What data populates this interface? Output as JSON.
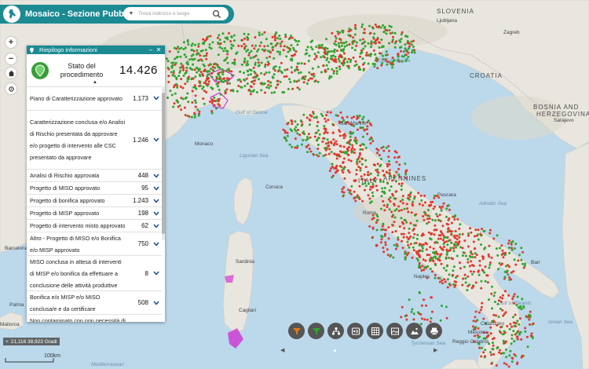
{
  "app": {
    "title": "Mosaico - Sezione Pubblica",
    "search_placeholder": "Trova indirizzo o luogo"
  },
  "nav": {
    "zoom_in": "+",
    "zoom_out": "−"
  },
  "panel": {
    "title": "Riepilogo informazioni",
    "header_label": "Stato del procedimento",
    "total": "14.426",
    "rows": [
      {
        "label": "Piano di Caratterizzazione approvato",
        "value": "1.173"
      },
      {
        "label": "Caratterizzazione conclusa e/o Analisi di Rischio presentata da approvare e/o progetto di intervento alle CSC presentato da approvare",
        "value": "1.246"
      },
      {
        "label": "Analisi di Rischio approvata",
        "value": "448"
      },
      {
        "label": "Progetto di MISO approvato",
        "value": "95"
      },
      {
        "label": "Progetto di bonifica approvato",
        "value": "1.243"
      },
      {
        "label": "Progetto di MISP approvato",
        "value": "198"
      },
      {
        "label": "Progetto di intervento misto approvato",
        "value": "62"
      },
      {
        "label": "Altro - Progetto di MISO e/o Bonifica e/o MISP approvato",
        "value": "750"
      },
      {
        "label": "MISO conclusa in attesa di interventi di MISP e/o bonifica da effettuare a conclusione delle attività produttive",
        "value": "8"
      },
      {
        "label": "Bonifica e/o MISP e/o MISO conclusa/e e da certificare",
        "value": "508"
      },
      {
        "label": "Non contaminato con non necessità di",
        "value": ""
      }
    ]
  },
  "coords": "21,116 38,923 Gradi",
  "scale_label": "100km",
  "map_labels": [
    {
      "name": "SLOVENIA",
      "cls": "big"
    },
    {
      "name": "Ljubljana",
      "cls": "city"
    },
    {
      "name": "Zagreb",
      "cls": "city"
    },
    {
      "name": "CROATIA",
      "cls": "big"
    },
    {
      "name": "BOSNIA AND",
      "cls": "big"
    },
    {
      "name": "HERZEGOVINA",
      "cls": "big"
    },
    {
      "name": "Sarajevo",
      "cls": "city"
    },
    {
      "name": "Gulf of Venice",
      "cls": "sea"
    },
    {
      "name": "Gulf of Genoa",
      "cls": "sea"
    },
    {
      "name": "Monaco",
      "cls": "city"
    },
    {
      "name": "Ligurian Sea",
      "cls": "sea"
    },
    {
      "name": "San Marino",
      "cls": "city"
    },
    {
      "name": "APENNINES",
      "cls": "big"
    },
    {
      "name": "ITALY",
      "cls": "big"
    },
    {
      "name": "Adriatic Sea",
      "cls": "sea"
    },
    {
      "name": "Corsica",
      "cls": "city"
    },
    {
      "name": "Rome",
      "cls": "city"
    },
    {
      "name": "Pescara",
      "cls": "city"
    },
    {
      "name": "Naples",
      "cls": "city"
    },
    {
      "name": "Bari",
      "cls": "city"
    },
    {
      "name": "Barcelona",
      "cls": "city"
    },
    {
      "name": "Tyrrhenian Sea",
      "cls": "sea"
    },
    {
      "name": "Sardinia",
      "cls": "city"
    },
    {
      "name": "Cagliari",
      "cls": "city"
    },
    {
      "name": "Palma",
      "cls": "city"
    },
    {
      "name": "Mallorca",
      "cls": "city"
    },
    {
      "name": "Mediterranean",
      "cls": "sea"
    },
    {
      "name": "Ionian Sea",
      "cls": "sea"
    },
    {
      "name": "Gulf of Taranto",
      "cls": "sea"
    },
    {
      "name": "Catanzaro",
      "cls": "city"
    },
    {
      "name": "Messina",
      "cls": "city"
    },
    {
      "name": "Reggio Calabria",
      "cls": "city"
    }
  ],
  "colors": {
    "brand": "#1b8a93",
    "marker_green": "#2fa62f",
    "marker_red": "#e0382b",
    "filter_active": "#e07a1a"
  },
  "toolbar_icons": [
    "filter-funnel-icon",
    "active-filter-icon",
    "layers-tree-icon",
    "legend-icon",
    "table-icon",
    "basemap-icon",
    "map-image-icon",
    "print-icon"
  ]
}
